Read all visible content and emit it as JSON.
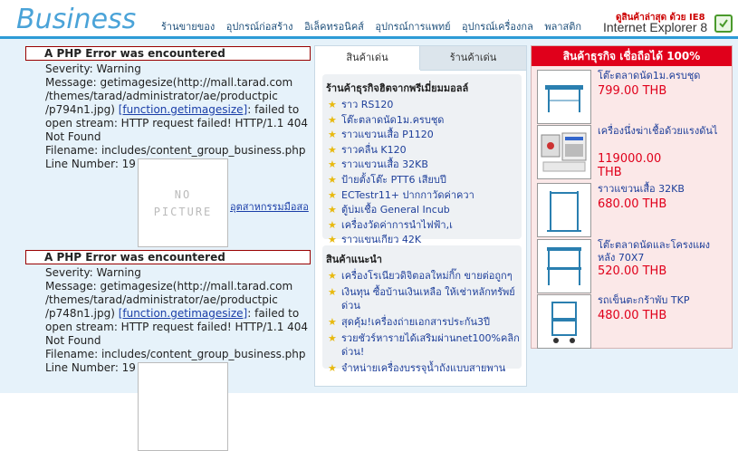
{
  "header": {
    "logo": "Business",
    "categories": [
      "ร้านขายของ",
      "อุปกรณ์ก่อสร้าง",
      "อิเล็คทรอนิคส์",
      "อุปกรณ์การแพทย์",
      "อุปกรณ์เครื่องกล",
      "พลาสติก"
    ],
    "ie_promo_line1": "ดูสินค้าล่าสุด ด้วย IE8",
    "ie_promo_line2": "Internet Explorer 8"
  },
  "errors": [
    {
      "heading": "A PHP Error was encountered",
      "severity": "Severity: Warning",
      "message_pre": "Message: getimagesize(http://mall.tarad.com /themes/tarad/administrator/ae/productpic /p794n1.jpg) ",
      "message_link": "[function.getimagesize]",
      "message_post": ": failed to open stream: HTTP request failed! HTTP/1.1 404 Not Found",
      "filename": "Filename: includes/content_group_business.php",
      "line": "Line Number: 19"
    },
    {
      "heading": "A PHP Error was encountered",
      "severity": "Severity: Warning",
      "message_pre": "Message: getimagesize(http://mall.tarad.com /themes/tarad/administrator/ae/productpic /p748n1.jpg) ",
      "message_link": "[function.getimagesize]",
      "message_post": ": failed to open stream: HTTP request failed! HTTP/1.1 404 Not Found",
      "filename": "Filename: includes/content_group_business.php",
      "line": "Line Number: 19"
    }
  ],
  "no_picture": {
    "line1": "NO",
    "line2": "PICTURE"
  },
  "side_link": "อุตสาหกรรมมือสอ",
  "tabs": [
    "สินค้าเด่น",
    "ร้านค้าเด่น"
  ],
  "premium_panel": {
    "title": "ร้านค้าธุรกิจฮิตจากพรีเมี่ยมมอลล์",
    "items": [
      "ราว RS120",
      "โต๊ะตลาดนัด1ม.ครบชุด",
      "ราวแขวนเสื้อ P1120",
      "ราวคลื่น K120",
      "ราวแขวนเสื้อ 32KB",
      "ป้ายตั้งโต๊ะ PTT6 เสียบปี",
      "ECTestr11+ ปากกาวัดค่าควา",
      "ตู้บ่มเชื้อ General Incub",
      "เครื่องวัดค่าการนำไฟฟ้า,เ",
      "ราวแขนเกียว 42K"
    ]
  },
  "recommend_panel": {
    "title": "สินค้าแนะนำ",
    "items": [
      "เครื่องโรเนียวดิจิตอลใหม่กิ๊ก ขายต่อถูกๆ",
      "เงินทุน ซื้อบ้านเงินเหลือ ให้เช่าหลักทรัพย์ด่วน",
      "สุดคุ้ม!เครื่องถ่ายเอกสารประกัน3ปี",
      "รวยชัวร์หารายได้เสริมผ่านnet100%คลิกด่วน!",
      "จำหน่ายเครื่องบรรจุน้ำถังแบบสายพาน"
    ]
  },
  "right_panel": {
    "title": "สินค้าธุรกิจ เชื่อถือได้ 100%",
    "items": [
      {
        "name": "โต๊ะตลาดนัด1ม.ครบชุด",
        "price": "799.00 THB"
      },
      {
        "name": "เครื่องนึ่งฆ่าเชื้อด้วยแรงดันไ",
        "price": "119000.00 THB"
      },
      {
        "name": "ราวแขวนเสื้อ 32KB",
        "price": "680.00 THB"
      },
      {
        "name": "โต๊ะตลาดนัดและโครงแผงหลัง 70X7",
        "price": "520.00 THB"
      },
      {
        "name": "รถเข็นตะกร้าพับ TKP",
        "price": "480.00 THB"
      }
    ]
  }
}
